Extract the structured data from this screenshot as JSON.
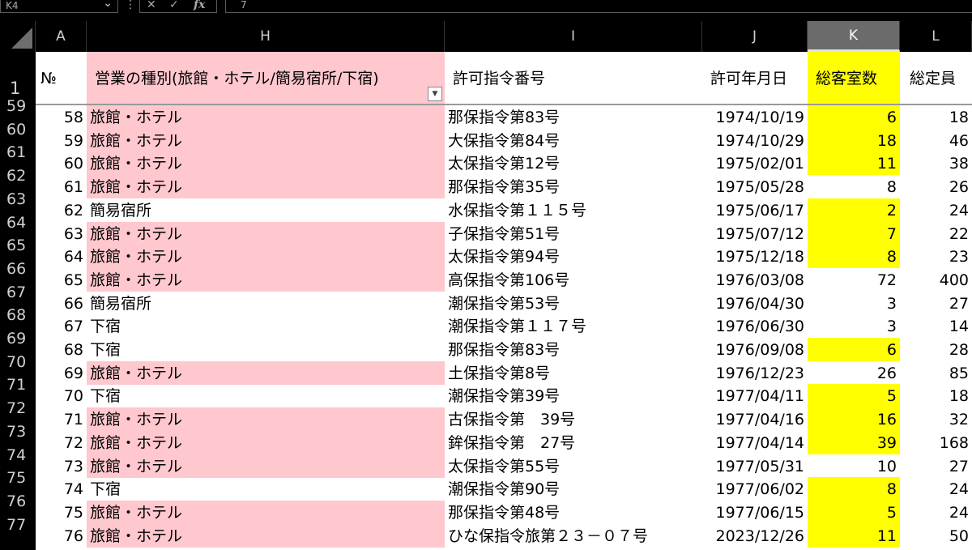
{
  "formula_bar": {
    "name_box": "K4",
    "formula": "7",
    "fx": "fx"
  },
  "columns": [
    "A",
    "H",
    "I",
    "J",
    "K",
    "L"
  ],
  "row_numbers": [
    "1",
    "59",
    "60",
    "61",
    "62",
    "63",
    "64",
    "65",
    "66",
    "67",
    "68",
    "69",
    "70",
    "71",
    "72",
    "73",
    "74",
    "75",
    "76",
    "77"
  ],
  "header": {
    "no": "№",
    "type": "営業の種別(旅館・ホテル/簡易宿所/下宿)",
    "permit_no": "許可指令番号",
    "permit_date": "許可年月日",
    "rooms": "総客室数",
    "capacity": "総定員"
  },
  "rows": [
    {
      "no": "58",
      "type": "旅館・ホテル",
      "permit": "那保指令第83号",
      "date": "1974/10/19",
      "rooms": "6",
      "cap": "18",
      "pink": true,
      "yellow": true
    },
    {
      "no": "59",
      "type": "旅館・ホテル",
      "permit": "大保指令第84号",
      "date": "1974/10/29",
      "rooms": "18",
      "cap": "46",
      "pink": true,
      "yellow": true
    },
    {
      "no": "60",
      "type": "旅館・ホテル",
      "permit": "太保指令第12号",
      "date": "1975/02/01",
      "rooms": "11",
      "cap": "38",
      "pink": true,
      "yellow": true
    },
    {
      "no": "61",
      "type": "旅館・ホテル",
      "permit": "那保指令第35号",
      "date": "1975/05/28",
      "rooms": "8",
      "cap": "26",
      "pink": true,
      "yellow": false
    },
    {
      "no": "62",
      "type": "簡易宿所",
      "permit": "水保指令第１１５号",
      "date": "1975/06/17",
      "rooms": "2",
      "cap": "24",
      "pink": false,
      "yellow": true
    },
    {
      "no": "63",
      "type": "旅館・ホテル",
      "permit": "子保指令第51号",
      "date": "1975/07/12",
      "rooms": "7",
      "cap": "22",
      "pink": true,
      "yellow": true
    },
    {
      "no": "64",
      "type": "旅館・ホテル",
      "permit": "太保指令第94号",
      "date": "1975/12/18",
      "rooms": "8",
      "cap": "23",
      "pink": true,
      "yellow": true
    },
    {
      "no": "65",
      "type": "旅館・ホテル",
      "permit": "高保指令第106号",
      "date": "1976/03/08",
      "rooms": "72",
      "cap": "400",
      "pink": true,
      "yellow": false
    },
    {
      "no": "66",
      "type": "簡易宿所",
      "permit": "潮保指令第53号",
      "date": "1976/04/30",
      "rooms": "3",
      "cap": "27",
      "pink": false,
      "yellow": false
    },
    {
      "no": "67",
      "type": "下宿",
      "permit": "潮保指令第１１７号",
      "date": "1976/06/30",
      "rooms": "3",
      "cap": "14",
      "pink": false,
      "yellow": false
    },
    {
      "no": "68",
      "type": "下宿",
      "permit": "那保指令第83号",
      "date": "1976/09/08",
      "rooms": "6",
      "cap": "28",
      "pink": false,
      "yellow": true
    },
    {
      "no": "69",
      "type": "旅館・ホテル",
      "permit": "土保指令第8号",
      "date": "1976/12/23",
      "rooms": "26",
      "cap": "85",
      "pink": true,
      "yellow": false
    },
    {
      "no": "70",
      "type": "下宿",
      "permit": "潮保指令第39号",
      "date": "1977/04/11",
      "rooms": "5",
      "cap": "18",
      "pink": false,
      "yellow": true
    },
    {
      "no": "71",
      "type": "旅館・ホテル",
      "permit": "古保指令第　39号",
      "date": "1977/04/16",
      "rooms": "16",
      "cap": "32",
      "pink": true,
      "yellow": true
    },
    {
      "no": "72",
      "type": "旅館・ホテル",
      "permit": "鉾保指令第　27号",
      "date": "1977/04/14",
      "rooms": "39",
      "cap": "168",
      "pink": true,
      "yellow": true
    },
    {
      "no": "73",
      "type": "旅館・ホテル",
      "permit": "太保指令第55号",
      "date": "1977/05/31",
      "rooms": "10",
      "cap": "27",
      "pink": true,
      "yellow": false
    },
    {
      "no": "74",
      "type": "下宿",
      "permit": "潮保指令第90号",
      "date": "1977/06/02",
      "rooms": "8",
      "cap": "24",
      "pink": false,
      "yellow": true
    },
    {
      "no": "75",
      "type": "旅館・ホテル",
      "permit": "那保指令第48号",
      "date": "1977/06/15",
      "rooms": "5",
      "cap": "24",
      "pink": true,
      "yellow": true
    },
    {
      "no": "76",
      "type": "旅館・ホテル",
      "permit": "ひな保指令旅第２３－０７号",
      "date": "2023/12/26",
      "rooms": "11",
      "cap": "50",
      "pink": true,
      "yellow": true
    }
  ],
  "colors": {
    "pink": "#ffc7ce",
    "yellow": "#ffff00",
    "active_header": "#6b6b6b"
  }
}
